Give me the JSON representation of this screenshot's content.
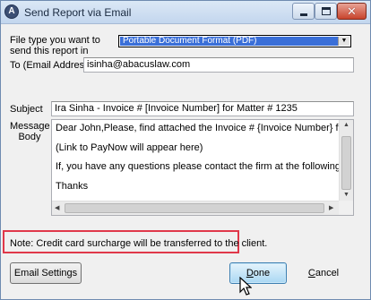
{
  "window": {
    "title": "Send Report via Email",
    "app_icon_letter": "A"
  },
  "form": {
    "file_type_label_1": "File type you want to",
    "file_type_label_2": "send this report in",
    "file_type_value": "Portable Document Format (PDF)",
    "to_label": "To (Email Address)",
    "to_value": "isinha@abacuslaw.com",
    "subject_label": "Subject",
    "subject_value": "Ira Sinha - Invoice # [Invoice Number] for Matter  # 1235",
    "message_label_1": "Message",
    "message_label_2": "Body",
    "message_lines": [
      "Dear John,Please, find attached the Invoice # {Invoice Number} for Matter",
      "(Link to PayNow will appear here)",
      "If, you have any questions please contact the firm at the following address:",
      "Thanks",
      ""
    ]
  },
  "note": "Note: Credit card surcharge will be transferred to the client.",
  "buttons": {
    "email_settings": "Email Settings",
    "done_prefix": "",
    "done_underlined": "D",
    "done_rest": "one",
    "cancel_prefix": "",
    "cancel_underlined": "C",
    "cancel_rest": "ancel"
  },
  "colors": {
    "highlight": "#3a6fd8",
    "note_border": "#e0384a",
    "done_button": "#a9d7f3"
  }
}
